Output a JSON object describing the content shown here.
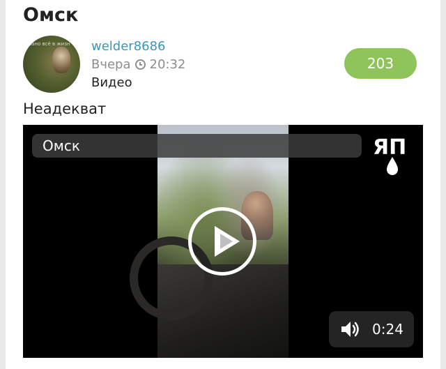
{
  "post": {
    "community": "Омск",
    "author": "welder8686",
    "date": "Вчера",
    "time": "20:32",
    "type": "Видео",
    "rating": "203",
    "text": "Неадекват"
  },
  "avatar": {
    "caption": "вано всё в жизн"
  },
  "video": {
    "caption": "Омск",
    "logo": "ЯП",
    "duration": "0:24",
    "icons": [
      "play-icon",
      "speaker-icon",
      "clock-icon"
    ]
  },
  "colors": {
    "username": "#3a96b8",
    "rating_bg": "#8fc45b",
    "meta": "#8d8d8d"
  }
}
